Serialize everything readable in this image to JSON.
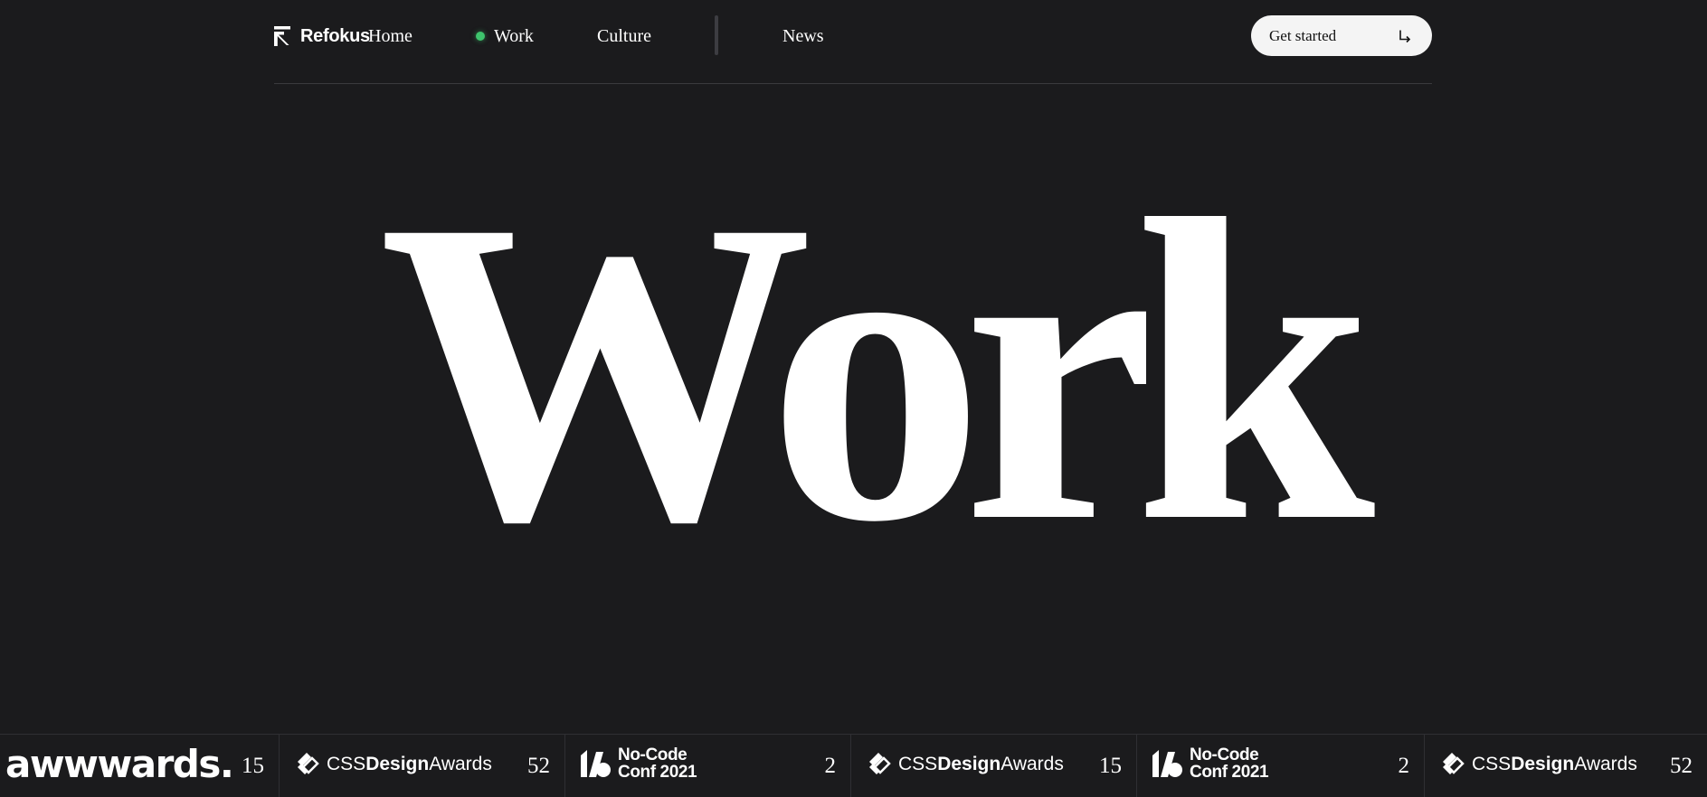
{
  "nav": {
    "brand": "Refokus",
    "brand_icon": "refokus-arrow-icon",
    "links": {
      "home": "Home",
      "work": "Work",
      "culture": "Culture",
      "news": "News"
    },
    "active_link": "Work",
    "active_color": "#3ec46d",
    "cta_label": "Get started",
    "cta_icon": "arrow-down-right-icon"
  },
  "hero": {
    "title": "Work"
  },
  "awards": [
    {
      "logo": "awwwards",
      "logo_text": "awwwards.",
      "count": "15"
    },
    {
      "logo": "css-design-awards",
      "logo_prefix": "CSS",
      "logo_bold": "Design",
      "logo_suffix": "Awards",
      "count": "52"
    },
    {
      "logo": "no-code-conf",
      "logo_line1": "No-Code",
      "logo_line2": "Conf 2021",
      "count": "2"
    },
    {
      "logo": "css-design-awards",
      "logo_prefix": "CSS",
      "logo_bold": "Design",
      "logo_suffix": "Awards",
      "count": "15"
    },
    {
      "logo": "no-code-conf",
      "logo_line1": "No-Code",
      "logo_line2": "Conf 2021",
      "count": "2"
    },
    {
      "logo": "css-design-awards",
      "logo_prefix": "CSS",
      "logo_bold": "Design",
      "logo_suffix": "Awards",
      "count": "52"
    }
  ],
  "colors": {
    "background": "#1b1b1d",
    "text": "#ffffff",
    "cta_background": "#f4f4f4"
  }
}
